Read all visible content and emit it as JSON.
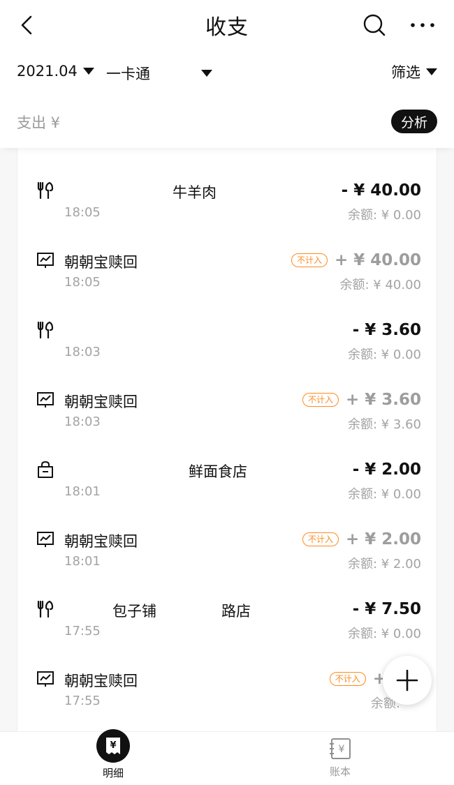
{
  "header": {
    "title": "收支",
    "back_icon": "chevron-left-icon",
    "search_icon": "search-icon",
    "more_icon": "more-horizontal-icon"
  },
  "filters": {
    "month": "2021.04",
    "card": "一卡通",
    "filter_label": "筛选"
  },
  "summary": {
    "expense_label": "支出 ¥",
    "analyze_label": "分析"
  },
  "transactions": [
    {
      "icon": "dining-icon",
      "name": "牛羊肉",
      "time": "18:05",
      "amount": "- ¥ 40.00",
      "balance": "余额: ¥ 0.00",
      "badge": ""
    },
    {
      "icon": "investment-chart-icon",
      "name": "朝朝宝赎回",
      "time": "18:05",
      "amount": "+ ¥ 40.00",
      "balance": "余额: ¥ 40.00",
      "badge": "不计入"
    },
    {
      "icon": "dining-icon",
      "name": "",
      "time": "18:03",
      "amount": "- ¥ 3.60",
      "balance": "余额: ¥ 0.00",
      "badge": ""
    },
    {
      "icon": "investment-chart-icon",
      "name": "朝朝宝赎回",
      "time": "18:03",
      "amount": "+ ¥ 3.60",
      "balance": "余额: ¥ 3.60",
      "badge": "不计入"
    },
    {
      "icon": "shopping-bag-icon",
      "name": "鲜面食店",
      "time": "18:01",
      "amount": "- ¥ 2.00",
      "balance": "余额: ¥ 0.00",
      "badge": ""
    },
    {
      "icon": "investment-chart-icon",
      "name": "朝朝宝赎回",
      "time": "18:01",
      "amount": "+ ¥ 2.00",
      "balance": "余额: ¥ 2.00",
      "badge": "不计入"
    },
    {
      "icon": "dining-icon",
      "name": "包子铺",
      "name2": "路店",
      "time": "17:55",
      "amount": "- ¥ 7.50",
      "balance": "余额: ¥ 0.00",
      "badge": ""
    },
    {
      "icon": "investment-chart-icon",
      "name": "朝朝宝赎回",
      "time": "17:55",
      "amount": "+ ¥",
      "balance": "余额:",
      "badge": "不计入"
    }
  ],
  "fab": {
    "icon": "plus-icon"
  },
  "bottom_nav": {
    "items": [
      {
        "label": "明细",
        "icon": "yuan-receipt-icon",
        "active": true
      },
      {
        "label": "账本",
        "icon": "yuan-ledger-icon",
        "active": false
      }
    ]
  }
}
